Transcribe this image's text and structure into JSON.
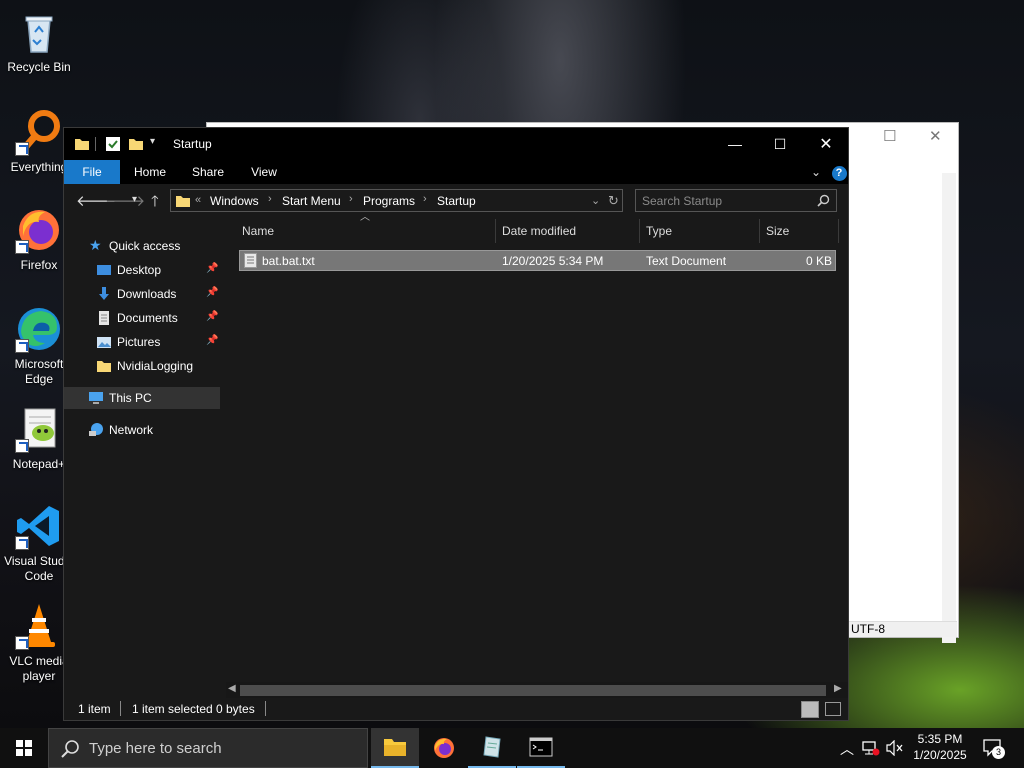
{
  "desktop": {
    "icons": [
      {
        "label": "Recycle Bin"
      },
      {
        "label": "Everything"
      },
      {
        "label": "Firefox"
      },
      {
        "label": "Microsoft Edge"
      },
      {
        "label": "Notepad+"
      },
      {
        "label": "Visual Studio Code"
      },
      {
        "label": "VLC media player"
      }
    ]
  },
  "notepad": {
    "encoding": "UTF-8"
  },
  "explorer": {
    "title": "Startup",
    "ribbon_tabs": [
      "File",
      "Home",
      "Share",
      "View"
    ],
    "breadcrumb_prefix": "«",
    "breadcrumb": [
      "Windows",
      "Start Menu",
      "Programs",
      "Startup"
    ],
    "search_placeholder": "Search Startup",
    "nav": {
      "quick_access": "Quick access",
      "items": [
        "Desktop",
        "Downloads",
        "Documents",
        "Pictures",
        "NvidiaLogging"
      ],
      "this_pc": "This PC",
      "network": "Network"
    },
    "columns": [
      "Name",
      "Date modified",
      "Type",
      "Size"
    ],
    "files": [
      {
        "name": "bat.bat.txt",
        "date": "1/20/2025 5:34 PM",
        "type": "Text Document",
        "size": "0 KB"
      }
    ],
    "status": {
      "count": "1 item",
      "selected": "1 item selected",
      "size": "0 bytes"
    }
  },
  "taskbar": {
    "search_placeholder": "Type here to search",
    "clock_time": "5:35 PM",
    "clock_date": "1/20/2025",
    "notification_count": "3"
  },
  "colors": {
    "accent": "#1979ca",
    "selection": "#777777",
    "window_bg": "#191919"
  }
}
